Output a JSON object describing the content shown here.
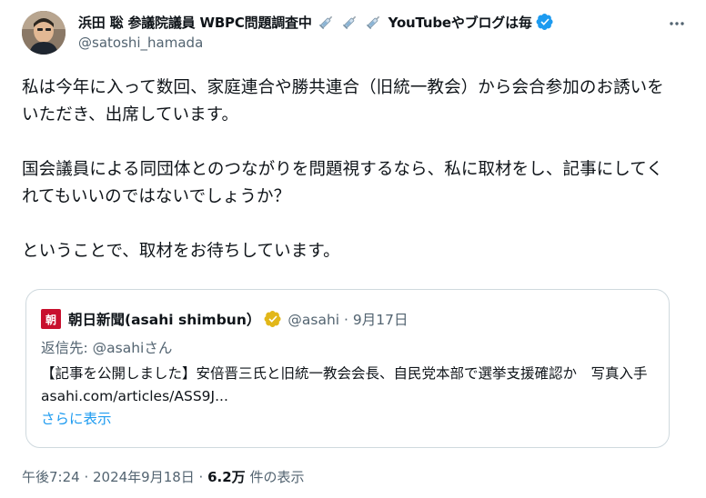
{
  "author": {
    "display_name": "浜田 聡 参議院議員 WBPC問題調査中",
    "name_suffix": "YouTubeやブログは毎",
    "handle": "@satoshi_hamada",
    "verified_color": "#1d9bf0"
  },
  "tweet": {
    "paragraphs": [
      "私は今年に入って数回、家庭連合や勝共連合（旧統一教会）から会合参加のお誘いをいただき、出席しています。",
      "国会議員による同団体とのつながりを問題視するなら、私に取材をし、記事にしてくれてもいいのではないでしょうか？",
      "ということで、取材をお待ちしています。"
    ]
  },
  "quote": {
    "logo_char": "朝",
    "display_name": "朝日新聞(asahi shimbun）",
    "handle_date": "@asahi · 9月17日",
    "reply_prefix": "返信先: ",
    "reply_to": "@asahiさん",
    "text": "【記事を公開しました】安倍晋三氏と旧統一教会会長、自民党本部で選挙支援確認か　写真入手 asahi.com/articles/ASS9J...",
    "show_more": "さらに表示",
    "badge_color": "#e2b719"
  },
  "meta": {
    "time": "午後7:24 · 2024年9月18日 · ",
    "views": "6.2万",
    "views_label": " 件の表示"
  },
  "icons": {
    "avatar": "avatar-photo",
    "syringe": "syringe-emoji",
    "verified": "verified-badge",
    "more": "more-icon"
  }
}
